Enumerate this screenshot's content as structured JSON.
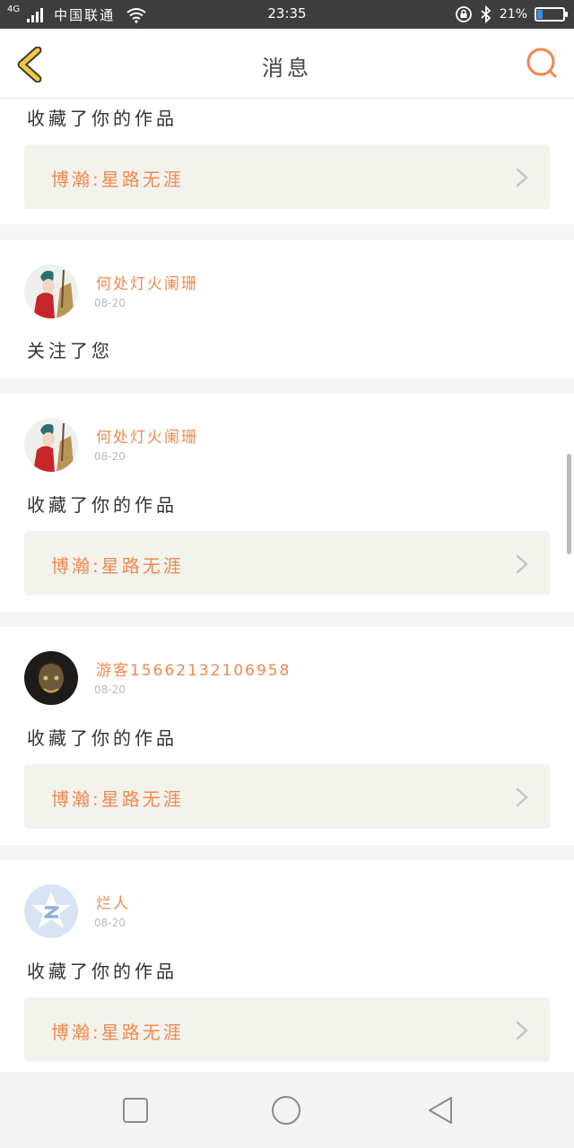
{
  "status_bar": {
    "network": "4G",
    "carrier": "中国联通",
    "time": "23:35",
    "battery": "21%",
    "battery_level": 0.21,
    "icons": [
      "signal-icon",
      "wifi-icon",
      "rotation-lock-icon",
      "bluetooth-icon",
      "battery-icon"
    ]
  },
  "header": {
    "title": "消息",
    "back_icon": "back-chevron-icon",
    "search_icon": "search-icon"
  },
  "colors": {
    "accent": "#f0884e",
    "back_icon": "#f5c842",
    "status_bar": "#3d3d3d",
    "work_card_bg": "#f3f3ee"
  },
  "messages": [
    {
      "action": "收藏了你的作品",
      "work_title": "博瀚:星路无涯"
    },
    {
      "user": "何处灯火阑珊",
      "date": "08-20",
      "action": "关注了您"
    },
    {
      "user": "何处灯火阑珊",
      "date": "08-20",
      "action": "收藏了你的作品",
      "work_title": "博瀚:星路无涯"
    },
    {
      "user": "游客15662132106958",
      "date": "08-20",
      "action": "收藏了你的作品",
      "work_title": "博瀚:星路无涯"
    },
    {
      "user": "烂人",
      "date": "08-20",
      "action": "收藏了你的作品",
      "work_title": "博瀚:星路无涯"
    }
  ],
  "nav_bar": {
    "icons": [
      "recent-apps-icon",
      "home-icon",
      "back-triangle-icon"
    ]
  }
}
